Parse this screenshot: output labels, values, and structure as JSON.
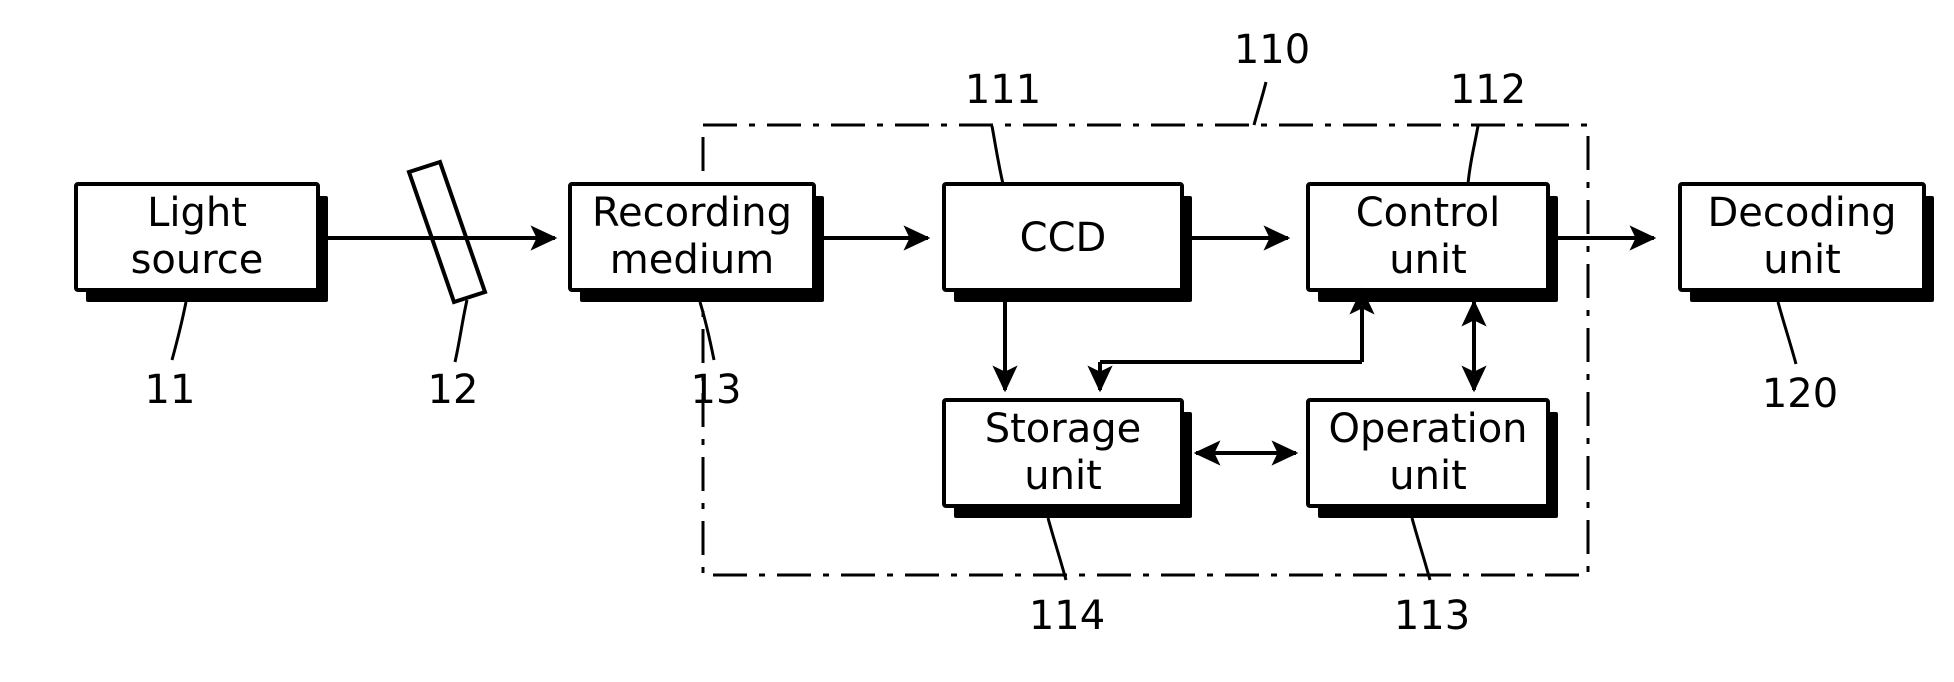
{
  "figure": {
    "type": "patent-block-diagram",
    "background_color": "#ffffff",
    "line_color": "#000000"
  },
  "blocks": [
    {
      "id": "light-source",
      "label_line1": "Light",
      "label_line2": "source",
      "ref": "11"
    },
    {
      "id": "mirror",
      "label_line1": "",
      "label_line2": "",
      "ref": "12"
    },
    {
      "id": "recording-medium",
      "label_line1": "Recording",
      "label_line2": "medium",
      "ref": "13"
    },
    {
      "id": "ccd",
      "label_line1": "CCD",
      "label_line2": "",
      "ref": "111"
    },
    {
      "id": "control-unit",
      "label_line1": "Control",
      "label_line2": "unit",
      "ref": "112"
    },
    {
      "id": "decoding-unit",
      "label_line1": "Decoding",
      "label_line2": "unit",
      "ref": "120"
    },
    {
      "id": "storage-unit",
      "label_line1": "Storage",
      "label_line2": "unit",
      "ref": "114"
    },
    {
      "id": "operation-unit",
      "label_line1": "Operation",
      "label_line2": "unit",
      "ref": "113"
    }
  ],
  "group": {
    "id": "apparatus-group",
    "ref": "110",
    "style": "dash-dot-boundary"
  },
  "labels": {
    "light_source_l1": "Light",
    "light_source_l2": "source",
    "recording_medium_l1": "Recording",
    "recording_medium_l2": "medium",
    "ccd": "CCD",
    "control_unit_l1": "Control",
    "control_unit_l2": "unit",
    "decoding_unit_l1": "Decoding",
    "decoding_unit_l2": "unit",
    "storage_unit_l1": "Storage",
    "storage_unit_l2": "unit",
    "operation_unit_l1": "Operation",
    "operation_unit_l2": "unit"
  },
  "refs": {
    "light_source": "11",
    "mirror": "12",
    "recording_medium": "13",
    "ccd": "111",
    "group": "110",
    "control_unit": "112",
    "decoding_unit": "120",
    "storage_unit": "114",
    "operation_unit": "113"
  }
}
